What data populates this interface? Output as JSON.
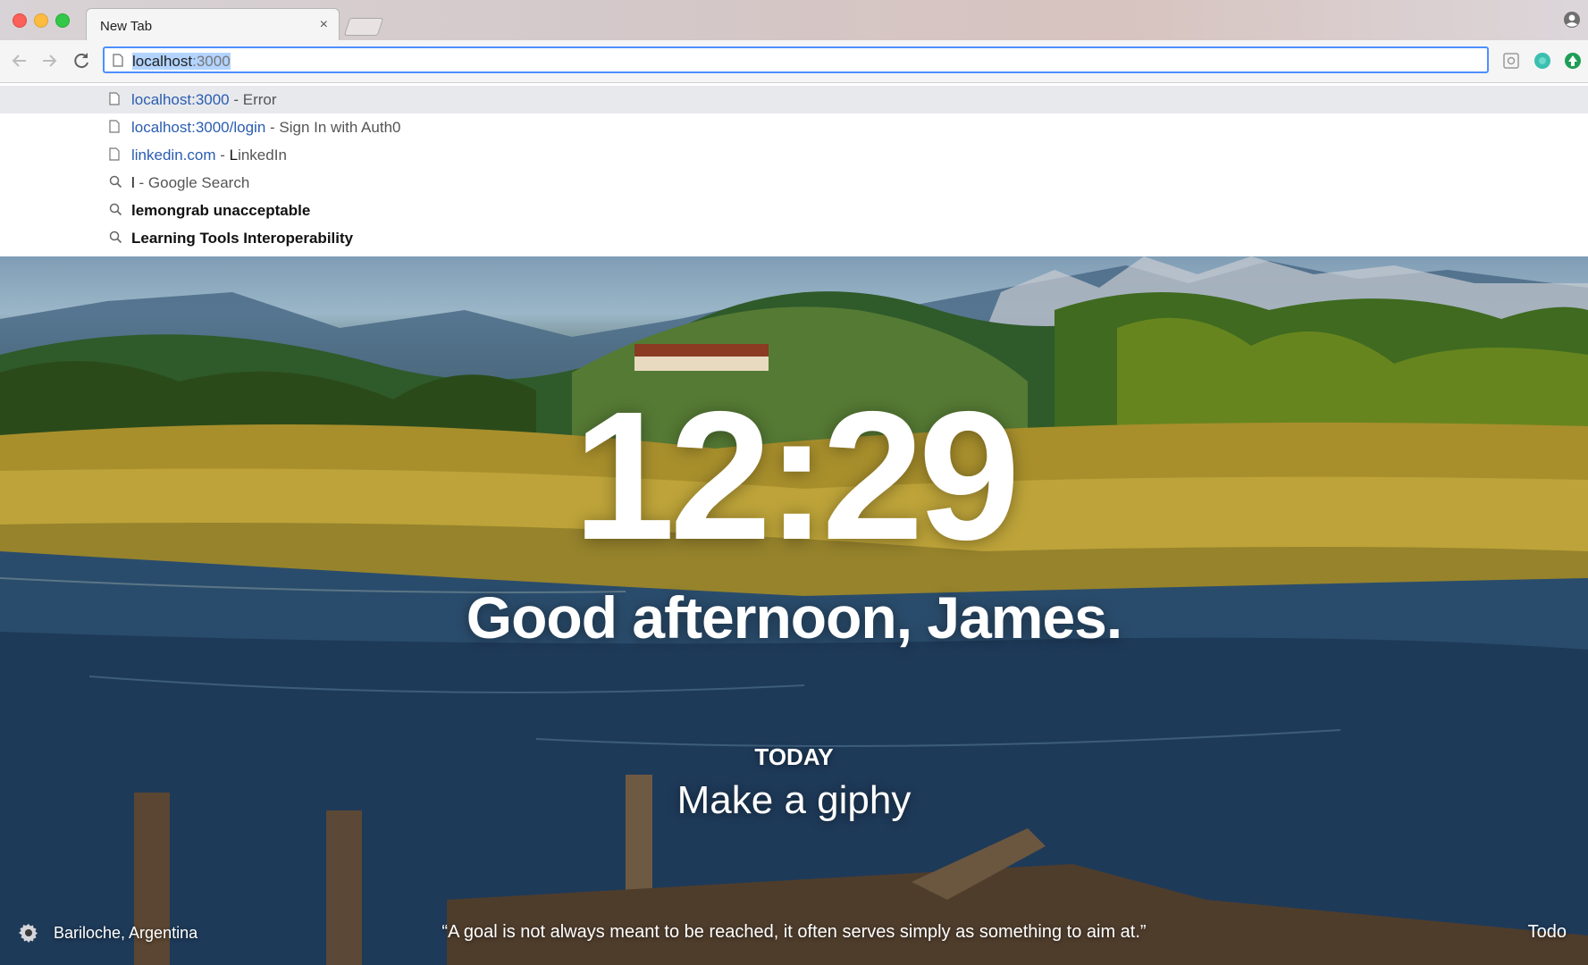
{
  "browser": {
    "tab_title": "New Tab",
    "tab_close": "×",
    "address_host": "localhost",
    "address_port": ":3000"
  },
  "suggestions": [
    {
      "icon": "page-icon",
      "url": "localhost:3000",
      "title": " - Error"
    },
    {
      "icon": "page-icon",
      "url": "localhost:3000/login",
      "title": " - Sign In with Auth0"
    },
    {
      "icon": "page-icon",
      "url": "linkedin.com",
      "title_prefix": " - ",
      "title_match": "L",
      "title_rest": "inkedIn"
    },
    {
      "icon": "search-icon",
      "match": "l",
      "title": " - Google Search"
    },
    {
      "icon": "search-icon",
      "text": "lemongrab unacceptable"
    },
    {
      "icon": "search-icon",
      "text": "Learning Tools Interoperability"
    }
  ],
  "dashboard": {
    "time": "12:29",
    "greeting": "Good afternoon, James.",
    "today_label": "TODAY",
    "focus": "Make a giphy",
    "location": "Bariloche, Argentina",
    "quote": "“A goal is not always meant to be reached, it often serves simply as something to aim at.”",
    "todo_label": "Todo"
  },
  "colors": {
    "focus_ring": "#4d90fe",
    "suggestion_url": "#2a5db0",
    "selected_row": "#e8e9ed"
  }
}
